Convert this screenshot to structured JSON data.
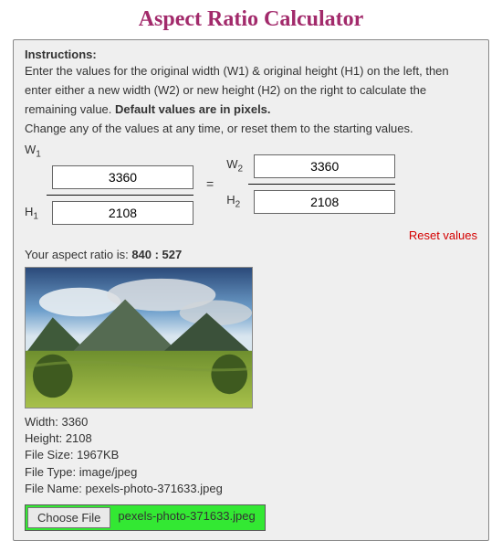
{
  "title": "Aspect Ratio Calculator",
  "instructions": {
    "heading": "Instructions:",
    "line1a": "Enter the values for the original width (W",
    "line1b": ") & original height (H",
    "line1c": ") on the left, then",
    "line2a": "enter either a new width (W",
    "line2b": ") or new height (H",
    "line2c": ") on the right to calculate the",
    "line3a": "remaining value. ",
    "line3b": "Default values are in pixels.",
    "line4": "Change any of the values at any time, or reset them to the starting values."
  },
  "labels": {
    "w1": "W",
    "h1": "H",
    "w2": "W",
    "h2": "H",
    "sub1": "1",
    "sub2": "2",
    "equals": "="
  },
  "values": {
    "w1": "3360",
    "h1": "2108",
    "w2": "3360",
    "h2": "2108"
  },
  "reset_label": "Reset values",
  "ratio": {
    "prefix": "Your aspect ratio is: ",
    "value": "840 : 527"
  },
  "meta": {
    "width_label": "Width: ",
    "width": "3360",
    "height_label": "Height: ",
    "height": "2108",
    "size_label": "File Size: ",
    "size": "1967KB",
    "type_label": "File Type: ",
    "type": "image/jpeg",
    "name_label": "File Name: ",
    "name": "pexels-photo-371633.jpeg"
  },
  "file": {
    "button": "Choose File",
    "selected": "pexels-photo-371633.jpeg"
  }
}
